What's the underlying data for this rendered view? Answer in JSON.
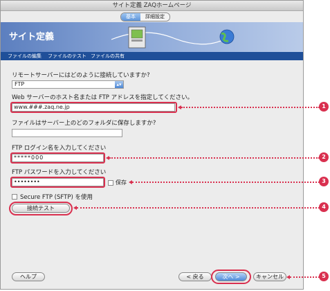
{
  "window": {
    "title": "サイト定義 ZAQホームページ",
    "tabs": [
      {
        "label": "基本"
      },
      {
        "label": "詳細設定"
      }
    ]
  },
  "banner": {
    "title": "サイト定義"
  },
  "nav": {
    "items": [
      {
        "label": "ファイルの編集"
      },
      {
        "label": "ファイルのテスト"
      },
      {
        "label": "ファイルの共有"
      }
    ]
  },
  "form": {
    "connect_question": "リモートサーバーにはどのように接続していますか?",
    "connect_value": "FTP",
    "host_label": "Web サーバーのホスト名または FTP アドレスを指定してください。",
    "host_value": "www.###.zaq.ne.jp",
    "folder_label": "ファイルはサーバー上のどのフォルダに保存しますか?",
    "folder_value": "",
    "login_label": "FTP ログイン名を入力してください",
    "login_value": "*****000",
    "password_label": "FTP パスワードを入力してください",
    "password_value": "••••••••",
    "save_label": "保存",
    "sftp_label": "Secure FTP (SFTP) を使用",
    "test_button": "接続テスト"
  },
  "footer": {
    "help": "ヘルプ",
    "back": "< 戻る",
    "next": "次へ >",
    "cancel": "キャンセル"
  },
  "annotations": [
    {
      "n": "1"
    },
    {
      "n": "2"
    },
    {
      "n": "3"
    },
    {
      "n": "4"
    },
    {
      "n": "5"
    }
  ],
  "colors": {
    "highlight": "#d9304f",
    "nav_bg": "#1f4f99",
    "accent_blue": "#4f8ad8"
  }
}
